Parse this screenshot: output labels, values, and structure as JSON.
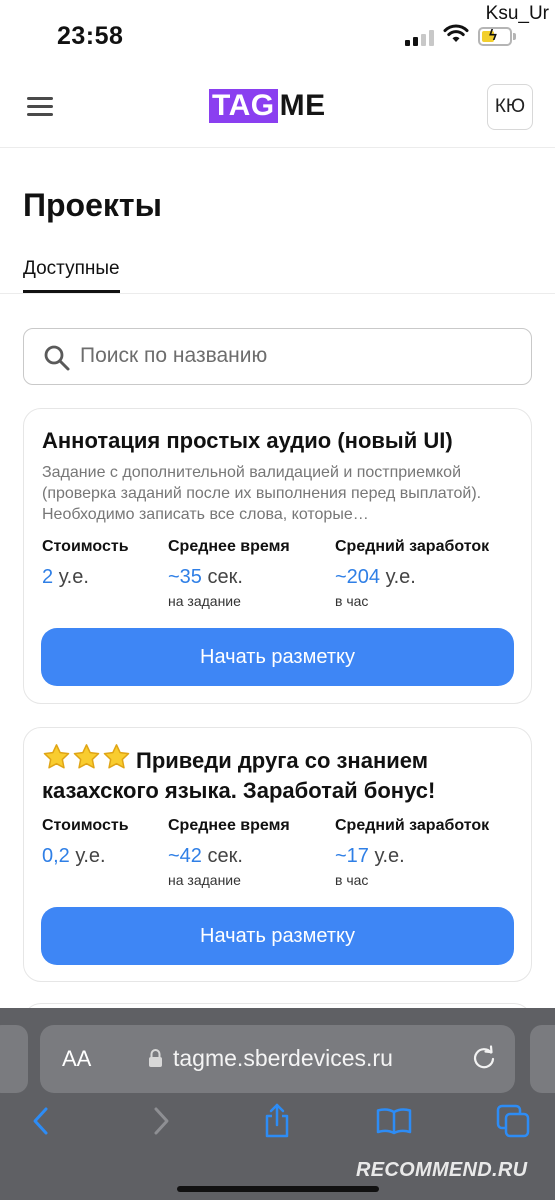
{
  "status_bar": {
    "time": "23:58",
    "user": "Ksu_Ur"
  },
  "header": {
    "logo_tag": "TAG",
    "logo_me": "ME",
    "avatar_initials": "КЮ"
  },
  "page": {
    "title": "Проекты",
    "tab_active": "Доступные"
  },
  "search": {
    "placeholder": "Поиск по названию"
  },
  "projects": [
    {
      "title": "Аннотация простых аудио (новый UI)",
      "description": "Задание с дополнительной валидацией и постприемкой (проверка заданий после их выполнения перед выплатой). Необходимо записать все слова, которые…",
      "cost_label": "Стоимость",
      "cost_value": "2",
      "cost_unit": "у.е.",
      "time_label": "Среднее время",
      "time_value": "~35",
      "time_unit": "сек.",
      "time_sub": "на задание",
      "earn_label": "Средний заработок",
      "earn_value": "~204",
      "earn_unit": "у.е.",
      "earn_sub": "в час",
      "button": "Начать разметку"
    },
    {
      "title": "Приведи друга со знанием казахского языка. Заработай бонус!",
      "title_icons": [
        "star-icon",
        "star-icon",
        "star-icon"
      ],
      "cost_label": "Стоимость",
      "cost_value": "0,2",
      "cost_unit": "у.е.",
      "time_label": "Среднее время",
      "time_value": "~42",
      "time_unit": "сек.",
      "time_sub": "на задание",
      "earn_label": "Средний заработок",
      "earn_value": "~17",
      "earn_unit": "у.е.",
      "earn_sub": "в час",
      "button": "Начать разметку"
    }
  ],
  "browser": {
    "text_size_label": "AA",
    "url": "tagme.sberdevices.ru",
    "toolbar_icons": [
      "back-icon",
      "forward-icon",
      "share-icon",
      "bookmarks-icon",
      "tabs-icon"
    ]
  },
  "watermark": "RECOMMEND.RU",
  "colors": {
    "brand_purple": "#8a3ff0",
    "accent_blue": "#3e86f5",
    "link_blue": "#2f7fe6"
  }
}
